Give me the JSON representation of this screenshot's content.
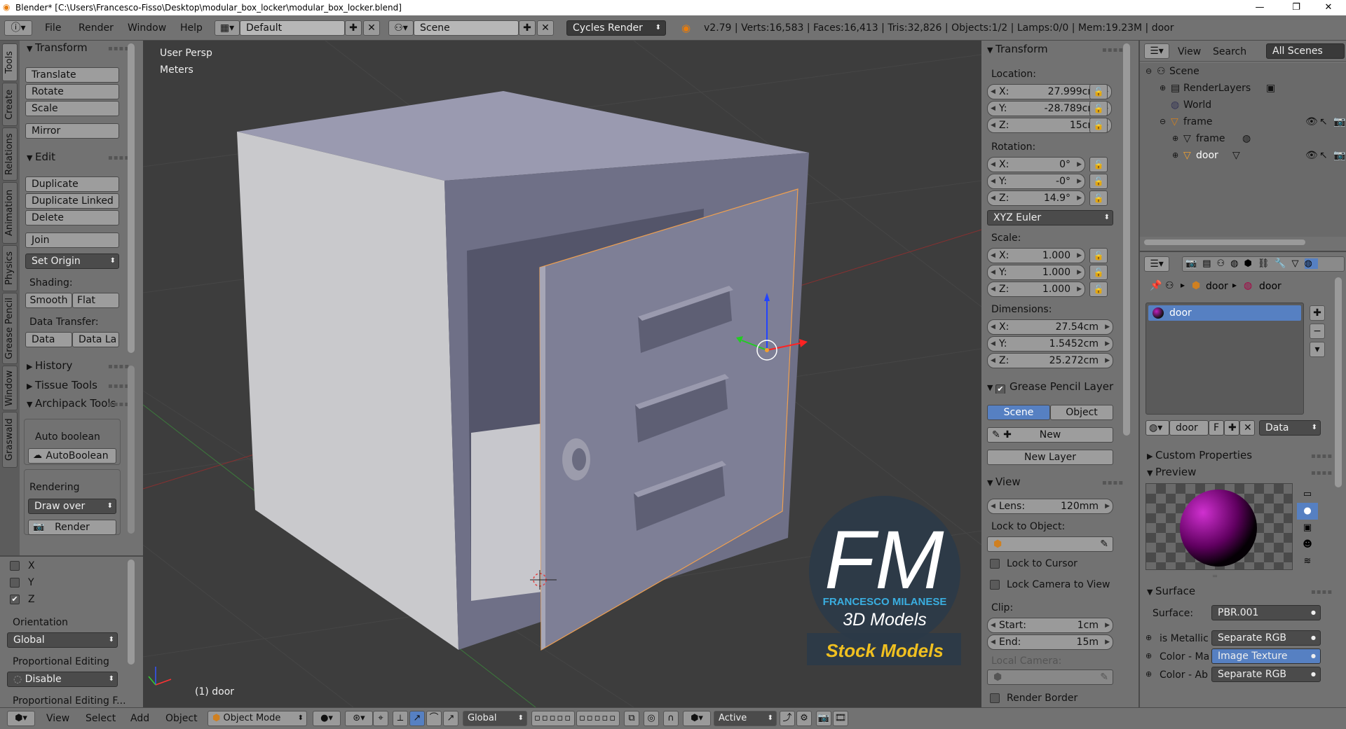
{
  "window": {
    "title": "Blender* [C:\\Users\\Francesco-Fisso\\Desktop\\modular_box_locker\\modular_box_locker.blend]",
    "minimize": "—",
    "maximize": "❐",
    "close": "✕"
  },
  "menu": {
    "file": "File",
    "render": "Render",
    "window": "Window",
    "help": "Help",
    "layout": "Default",
    "scene": "Scene",
    "engine": "Cycles Render",
    "stats": "v2.79 | Verts:16,583 | Faces:16,413 | Tris:32,826 | Objects:1/2 | Lamps:0/0 | Mem:19.23M | door"
  },
  "left_tabs": [
    "Tools",
    "Create",
    "Relations",
    "Animation",
    "Physics",
    "Grease Pencil",
    "Window",
    "Graswald"
  ],
  "tools": {
    "transform_header": "Transform",
    "translate": "Translate",
    "rotate": "Rotate",
    "scale": "Scale",
    "mirror": "Mirror",
    "edit_header": "Edit",
    "duplicate": "Duplicate",
    "duplicate_linked": "Duplicate Linked",
    "delete": "Delete",
    "join": "Join",
    "set_origin": "Set Origin",
    "shading_label": "Shading:",
    "smooth": "Smooth",
    "flat": "Flat",
    "data_transfer_label": "Data Transfer:",
    "data": "Data",
    "data_la": "Data La",
    "history": "History",
    "tissue": "Tissue Tools",
    "archipack": "Archipack Tools",
    "auto_boolean_label": "Auto boolean",
    "auto_boolean_btn": "AutoBoolean",
    "rendering_label": "Rendering",
    "draw_over": "Draw over",
    "render_btn": "Render",
    "axis_x": "X",
    "axis_y": "Y",
    "axis_z": "Z",
    "orientation_label": "Orientation",
    "orientation_value": "Global",
    "prop_edit_label": "Proportional Editing",
    "prop_edit_value": "Disable",
    "prop_edit_falloff": "Proportional Editing F..."
  },
  "viewport": {
    "view_name": "User Persp",
    "units": "Meters",
    "object_label": "(1) door",
    "watermark_letters": "FM",
    "watermark_name": "FRANCESCO MILANESE",
    "watermark_sub": "3D Models",
    "watermark_stock": "Stock Models"
  },
  "npanel": {
    "transform_header": "Transform",
    "location_label": "Location:",
    "loc_x": "27.999cm",
    "loc_y": "-28.789cm",
    "loc_z": "15cm",
    "rotation_label": "Rotation:",
    "rot_x": "0°",
    "rot_y": "-0°",
    "rot_z": "14.9°",
    "rot_mode": "XYZ Euler",
    "scale_label": "Scale:",
    "scale_x": "1.000",
    "scale_y": "1.000",
    "scale_z": "1.000",
    "dimensions_label": "Dimensions:",
    "dim_x": "27.54cm",
    "dim_y": "1.5452cm",
    "dim_z": "25.272cm",
    "axis_x": "X:",
    "axis_y": "Y:",
    "axis_z": "Z:",
    "gp_header": "Grease Pencil Layer",
    "gp_scene": "Scene",
    "gp_object": "Object",
    "gp_new": "New",
    "gp_new_layer": "New Layer",
    "view_header": "View",
    "lens_label": "Lens:",
    "lens_value": "120mm",
    "lock_object_label": "Lock to Object:",
    "lock_cursor": "Lock to Cursor",
    "lock_camera": "Lock Camera to View",
    "clip_label": "Clip:",
    "clip_start_label": "Start:",
    "clip_start": "1cm",
    "clip_end_label": "End:",
    "clip_end": "15m",
    "local_camera": "Local Camera:",
    "render_border": "Render Border"
  },
  "outliner": {
    "view": "View",
    "search": "Search",
    "all_scenes": "All Scenes",
    "scene": "Scene",
    "render_layers": "RenderLayers",
    "world": "World",
    "frame": "frame",
    "frame_mesh": "frame",
    "door": "door"
  },
  "props": {
    "breadcrumb_obj": "door",
    "breadcrumb_mat": "door",
    "material_slot": "door",
    "mat_name": "door",
    "mat_f": "F",
    "mat_link": "Data",
    "custom_props": "Custom Properties",
    "preview": "Preview",
    "surface_header": "Surface",
    "surface_label": "Surface:",
    "surface_value": "PBR.001",
    "metallic_label": "is Metallic",
    "metallic_value": "Separate RGB",
    "color_ma_label": "Color - Ma",
    "color_ma_value": "Image Texture",
    "color_ab_label": "Color - Ab",
    "color_ab_value": "Separate RGB"
  },
  "bottombar": {
    "view": "View",
    "select": "Select",
    "add": "Add",
    "object": "Object",
    "mode": "Object Mode",
    "orientation": "Global",
    "pivot": "Active"
  }
}
